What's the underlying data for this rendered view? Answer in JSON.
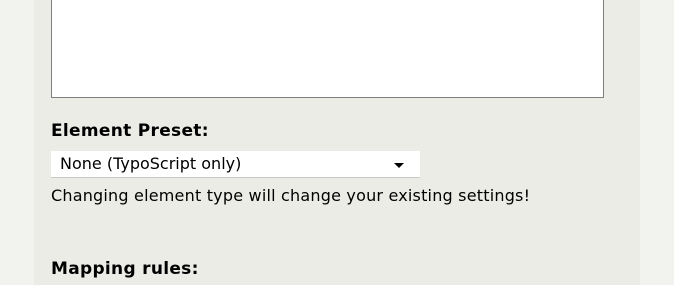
{
  "form": {
    "description_value": "",
    "element_preset": {
      "label": "Element Preset:",
      "selected": "None (TypoScript only)",
      "warning": "Changing element type will change your existing settings!"
    },
    "mapping_rules_label": "Mapping rules:"
  }
}
